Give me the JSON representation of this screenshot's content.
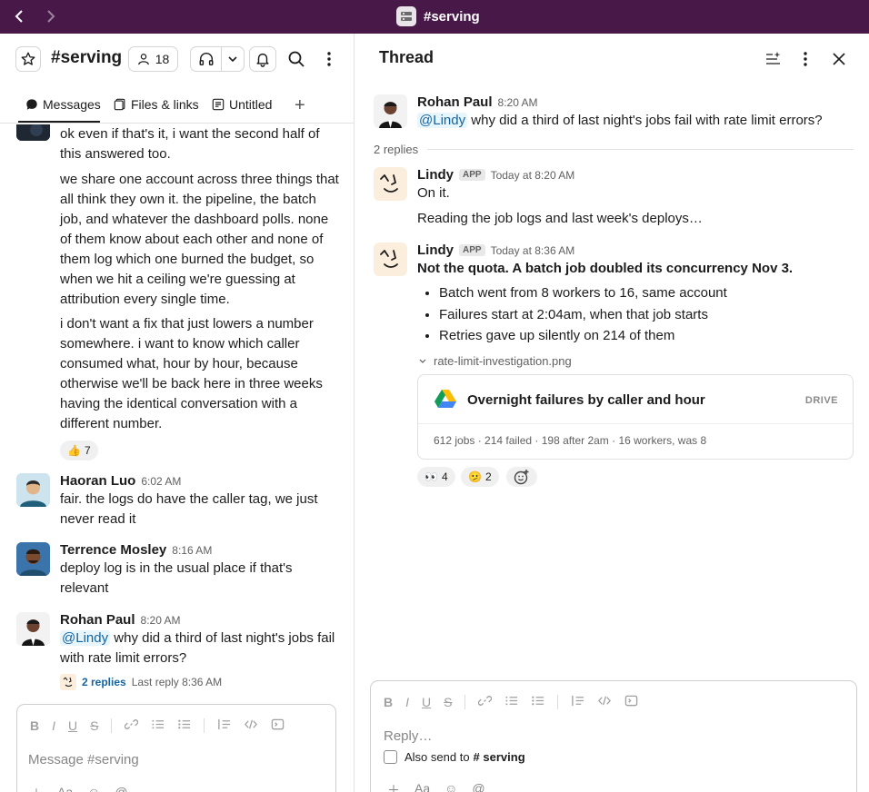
{
  "window": {
    "workspace_title": "#serving"
  },
  "channel": {
    "name": "#serving",
    "member_count": "18",
    "tabs": [
      {
        "label": "Messages"
      },
      {
        "label": "Files & links"
      },
      {
        "label": "Untitled"
      }
    ]
  },
  "messages": {
    "cont_1": "ok even if that's it, i want the second half of this answered too.",
    "cont_2": "we share one account across three things that all think they own it. the pipeline, the batch job, and whatever the dashboard polls. none of them know about each other and none of them log which one burned the budget, so when we hit a ceiling we're guessing at attribution every single time.",
    "cont_3": "i don't want a fix that just lowers a number somewhere. i want to know which caller consumed what, hour by hour, because otherwise we'll be back here in three weeks having the identical conversation with a different number.",
    "reaction_1": {
      "emoji": "👍",
      "count": "7"
    },
    "haoran": {
      "name": "Haoran Luo",
      "time": "6:02 AM",
      "text": "fair. the logs do have the caller tag, we just never read it"
    },
    "terrence": {
      "name": "Terrence Mosley",
      "time": "8:16 AM",
      "text": "deploy log is in the usual place if that's relevant"
    },
    "rohan": {
      "name": "Rohan Paul",
      "time": "8:20 AM",
      "mention": "@Lindy",
      "text": "why did a third of last night's jobs fail with rate limit errors?"
    },
    "replies": {
      "count": "2 replies",
      "last": "Last reply 8:36 AM"
    }
  },
  "composer": {
    "placeholder": "Message #serving"
  },
  "thread": {
    "title": "Thread",
    "parent": {
      "name": "Rohan Paul",
      "time": "8:20 AM",
      "mention": "@Lindy",
      "text": "why did a third of last night's jobs fail with rate limit errors?"
    },
    "reply_count": "2 replies",
    "reply_1": {
      "name": "Lindy",
      "badge": "APP",
      "time": "Today at 8:20 AM",
      "line1": "On it.",
      "line2": "Reading the job logs and last week's deploys…"
    },
    "reply_2": {
      "name": "Lindy",
      "badge": "APP",
      "time": "Today at 8:36 AM",
      "headline": "Not the quota. A batch job doubled its concurrency Nov 3.",
      "bullets": [
        "Batch went from 8 workers to 16, same account",
        "Failures start at 2:04am, when that job starts",
        "Retries gave up silently on 214 of them"
      ],
      "file_name": "rate-limit-investigation.png",
      "card": {
        "title": "Overnight failures by caller and hour",
        "source": "DRIVE",
        "summary": "612 jobs · 214 failed · 198 after 2am · 16 workers, was 8"
      },
      "reactions": [
        {
          "emoji": "👀",
          "count": "4"
        },
        {
          "emoji": "🫤",
          "count": "2"
        }
      ]
    },
    "composer": {
      "placeholder": "Reply…",
      "also_send_prefix": "Also send to",
      "also_send_channel": "# serving"
    }
  },
  "colors": {
    "topbar": "#481849",
    "link": "#1264a3",
    "mention_bg": "#e8f5fa"
  }
}
